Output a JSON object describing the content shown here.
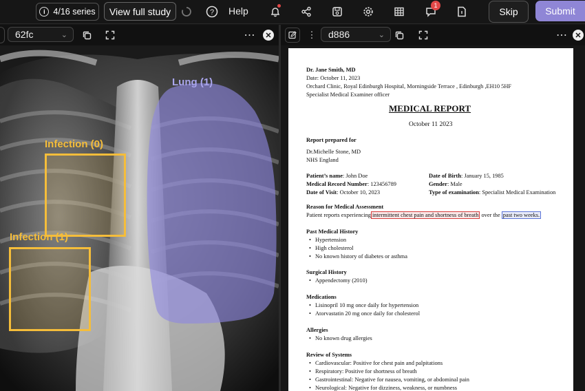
{
  "topbar": {
    "series_label": "4/16 series",
    "view_full_study": "View full study",
    "help": "Help",
    "notification_count": "1",
    "skip": "Skip",
    "submit": "Submit"
  },
  "left_viewer": {
    "series_id": "62fc"
  },
  "right_viewer": {
    "doc_id": "d886"
  },
  "annotations": {
    "lung": "Lung (1)",
    "infection0": "Infection (0)",
    "infection1": "Infection (1)"
  },
  "annotation_colors": {
    "lung": "#8e88e0",
    "infection": "#f5bd3a"
  },
  "report": {
    "doctor": "Dr. Jane Smith, MD",
    "date_line": "Date: October 11, 2023",
    "address": "Orchard Clinic, Royal Edinburgh Hospital, Morningside Terrace , Edinburgh ,EH10 5HF",
    "role": "Specialist Medical Examiner officer",
    "title": "MEDICAL REPORT",
    "report_date": "October 11 2023",
    "prepared_for_heading": "Report prepared for",
    "prepared_for_name": "Dr.Michelle Stone, MD",
    "prepared_for_org": "NHS England",
    "patient_name_label": "Patient’s name",
    "patient_name": ": John Doe",
    "mrn_label": "Medical Record Number",
    "mrn": ": 123456789",
    "visit_label": "Date of Visit",
    "visit": ": October 10, 2023",
    "dob_label": "Date of Birth",
    "dob": ": January 15, 1985",
    "gender_label": "Gender",
    "gender": ": Male",
    "exam_label": "Type of examination",
    "exam": ": Specialist Medical Examination",
    "reason_heading": "Reason for Medical Assessment",
    "reason_prefix": "Patient reports experiencing",
    "reason_highlight1": "intermittent chest pain and shortness of breath",
    "reason_middle": "over the",
    "reason_highlight2": "past two weeks.",
    "pmh_heading": "Past Medical History",
    "pmh": [
      "Hypertension",
      "High cholesterol",
      "No known history of diabetes or asthma"
    ],
    "surg_heading": "Surgical History",
    "surg": [
      "Appendectomy (2010)"
    ],
    "med_heading": "Medications",
    "meds": [
      "Lisinopril 10 mg once daily for hypertension",
      "Atorvastatin 20 mg once daily for cholesterol"
    ],
    "allergy_heading": "Allergies",
    "allergies": [
      "No known drug allergies"
    ],
    "ros_heading": "Review of Systems",
    "ros": [
      "Cardiovascular: Positive for chest pain and palpitations",
      "Respiratory: Positive for shortness of breath",
      "Gastrointestinal: Negative for nausea, vomiting, or abdominal pain",
      "Neurological: Negative for dizziness, weakness, or numbness"
    ]
  }
}
